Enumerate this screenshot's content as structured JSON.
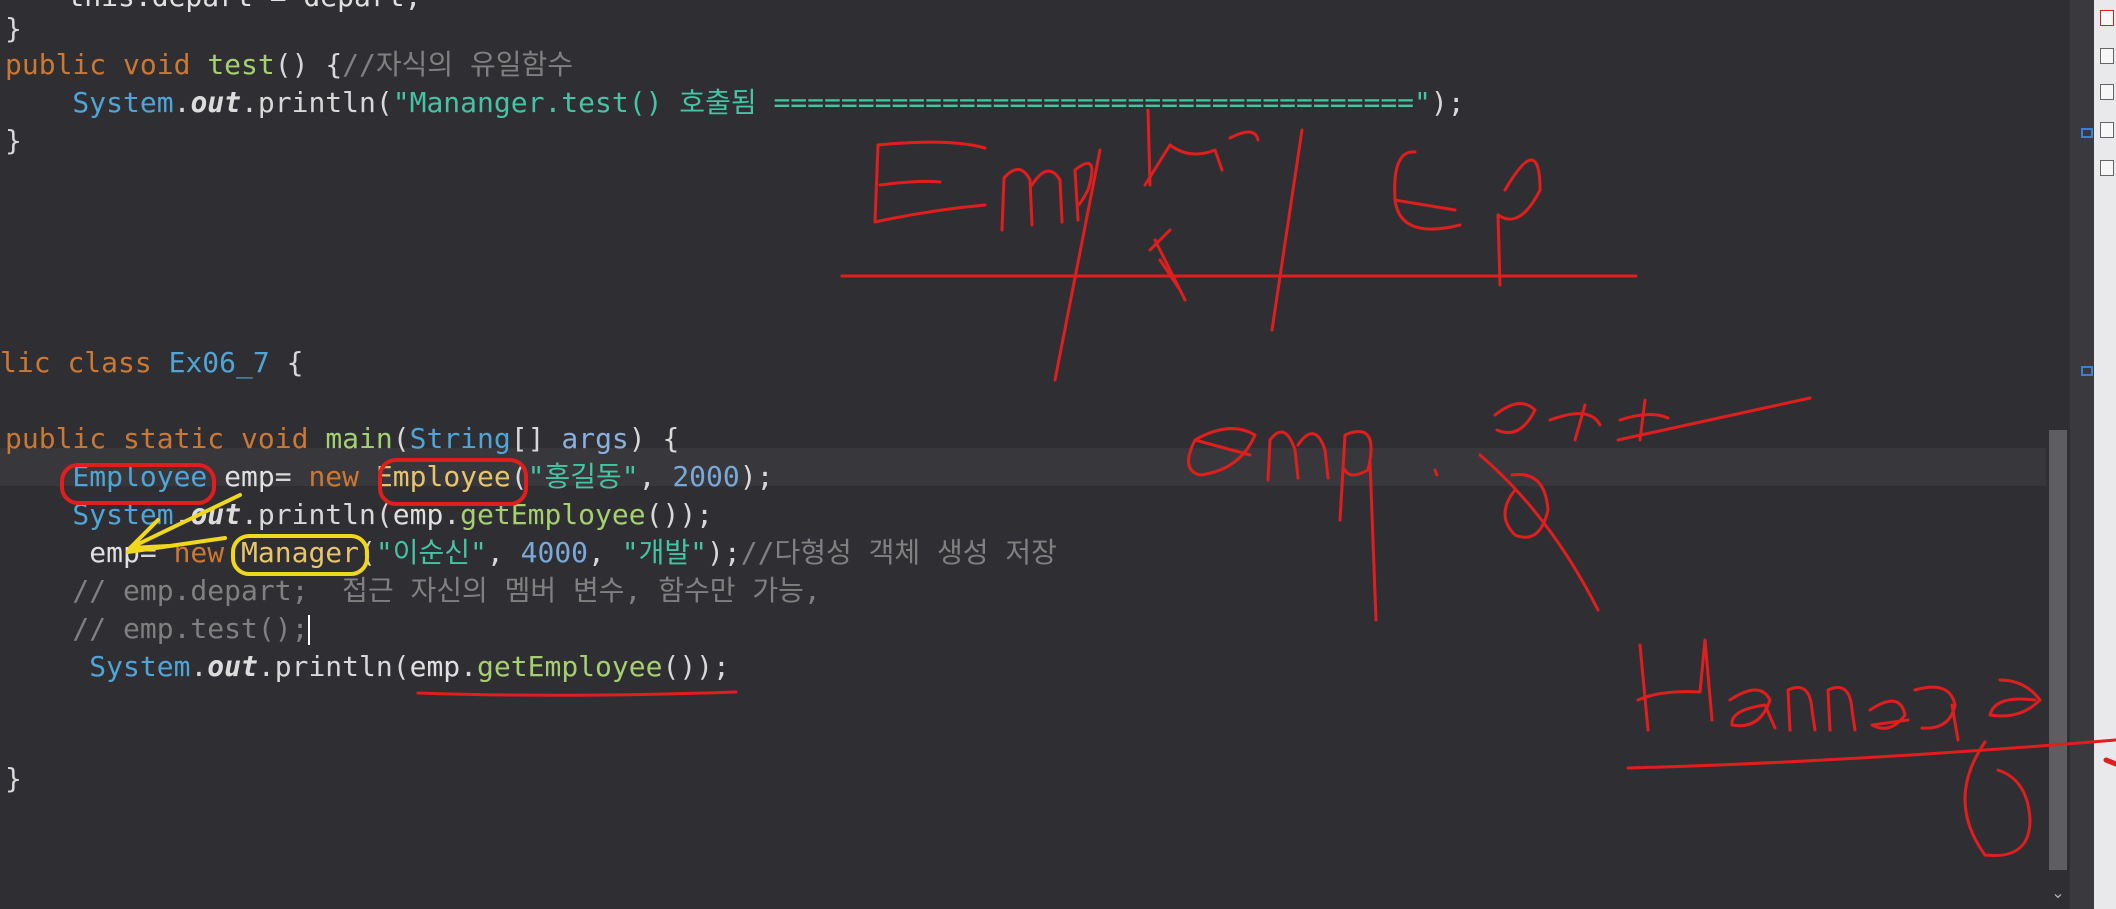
{
  "code_lines": [
    {
      "tokens": [
        {
          "t": "    this.depart = depart;",
          "c": "var"
        }
      ]
    },
    {
      "tokens": [
        {
          "t": "}",
          "c": "punc"
        }
      ]
    },
    {
      "tokens": [
        {
          "t": "public",
          "c": "kw"
        },
        {
          "t": " ",
          "c": "punc"
        },
        {
          "t": "void",
          "c": "kw"
        },
        {
          "t": " ",
          "c": "punc"
        },
        {
          "t": "test",
          "c": "meth"
        },
        {
          "t": "() {",
          "c": "punc"
        },
        {
          "t": "//자식의 유일함수",
          "c": "cmt"
        }
      ]
    },
    {
      "tokens": [
        {
          "t": "    System",
          "c": "type"
        },
        {
          "t": ".",
          "c": "punc"
        },
        {
          "t": "out",
          "c": "fld"
        },
        {
          "t": ".println(",
          "c": "punc"
        },
        {
          "t": "\"Mananger.test() 호출됨 ======================================\"",
          "c": "str"
        },
        {
          "t": ");",
          "c": "punc"
        }
      ]
    },
    {
      "tokens": [
        {
          "t": "}",
          "c": "punc"
        }
      ]
    },
    {
      "tokens": [
        {
          "t": "lic",
          "c": "kw"
        },
        {
          "t": " ",
          "c": "punc"
        },
        {
          "t": "class",
          "c": "kw"
        },
        {
          "t": " ",
          "c": "punc"
        },
        {
          "t": "Ex06_7",
          "c": "type"
        },
        {
          "t": " {",
          "c": "punc"
        }
      ]
    },
    {
      "tokens": [
        {
          "t": "public",
          "c": "kw"
        },
        {
          "t": " ",
          "c": "punc"
        },
        {
          "t": "static",
          "c": "kw"
        },
        {
          "t": " ",
          "c": "punc"
        },
        {
          "t": "void",
          "c": "kw"
        },
        {
          "t": " ",
          "c": "punc"
        },
        {
          "t": "main",
          "c": "meth"
        },
        {
          "t": "(",
          "c": "punc"
        },
        {
          "t": "String",
          "c": "type"
        },
        {
          "t": "[] ",
          "c": "punc"
        },
        {
          "t": "args",
          "c": "param"
        },
        {
          "t": ") {",
          "c": "punc"
        }
      ]
    },
    {
      "tokens": [
        {
          "t": "    Employee",
          "c": "type"
        },
        {
          "t": " ",
          "c": "punc"
        },
        {
          "t": "emp",
          "c": "var"
        },
        {
          "t": "= ",
          "c": "punc"
        },
        {
          "t": "new",
          "c": "kw"
        },
        {
          "t": " ",
          "c": "punc"
        },
        {
          "t": "Employee",
          "c": "cls"
        },
        {
          "t": "(",
          "c": "punc"
        },
        {
          "t": "\"홍길동\"",
          "c": "str"
        },
        {
          "t": ", ",
          "c": "punc"
        },
        {
          "t": "2000",
          "c": "num"
        },
        {
          "t": ");",
          "c": "punc"
        }
      ]
    },
    {
      "tokens": [
        {
          "t": "    System",
          "c": "type"
        },
        {
          "t": ".",
          "c": "punc"
        },
        {
          "t": "out",
          "c": "fld"
        },
        {
          "t": ".println(",
          "c": "punc"
        },
        {
          "t": "emp",
          "c": "var"
        },
        {
          "t": ".",
          "c": "punc"
        },
        {
          "t": "getEmployee",
          "c": "meth"
        },
        {
          "t": "());",
          "c": "punc"
        }
      ]
    },
    {
      "tokens": [
        {
          "t": "     emp",
          "c": "var"
        },
        {
          "t": "= ",
          "c": "punc"
        },
        {
          "t": "new",
          "c": "kw"
        },
        {
          "t": " ",
          "c": "punc"
        },
        {
          "t": "Manager",
          "c": "cls"
        },
        {
          "t": "(",
          "c": "punc"
        },
        {
          "t": "\"이순신\"",
          "c": "str"
        },
        {
          "t": ", ",
          "c": "punc"
        },
        {
          "t": "4000",
          "c": "num"
        },
        {
          "t": ", ",
          "c": "punc"
        },
        {
          "t": "\"개발\"",
          "c": "str"
        },
        {
          "t": ");",
          "c": "punc"
        },
        {
          "t": "//다형성 객체 생성 저장",
          "c": "cmt"
        }
      ]
    },
    {
      "tokens": [
        {
          "t": "    // emp.depart;  접근 자신의 멤버 변수, 함수만 가능,",
          "c": "cmt"
        }
      ]
    },
    {
      "tokens": [
        {
          "t": "    // emp.test();",
          "c": "cmt"
        }
      ],
      "caret": true
    },
    {
      "tokens": [
        {
          "t": "     System",
          "c": "type"
        },
        {
          "t": ".",
          "c": "punc"
        },
        {
          "t": "out",
          "c": "fld"
        },
        {
          "t": ".println(",
          "c": "punc"
        },
        {
          "t": "emp",
          "c": "var"
        },
        {
          "t": ".",
          "c": "punc"
        },
        {
          "t": "getEmployee",
          "c": "meth"
        },
        {
          "t": "());",
          "c": "punc"
        }
      ]
    },
    {
      "tokens": [
        {
          "t": "}",
          "c": "punc"
        }
      ]
    }
  ],
  "colors": {
    "editor_bg": "#2f2f33",
    "annotation_red": "#e01e1e",
    "annotation_yellow": "#f0d81c"
  },
  "icons": [
    "scrollbar-down-arrow-icon",
    "error-marker-icon",
    "outline-icon"
  ]
}
